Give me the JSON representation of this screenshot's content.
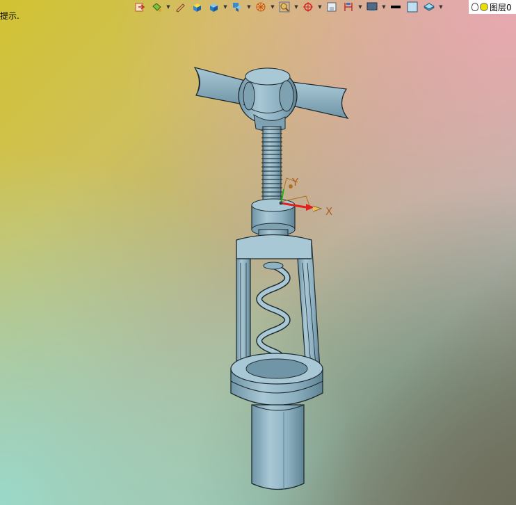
{
  "status": {
    "hint_text": "提示."
  },
  "toolbar": {
    "items": [
      {
        "name": "open-file-icon"
      },
      {
        "name": "paint-bucket-icon",
        "dropdown": true
      },
      {
        "name": "pen-icon"
      },
      {
        "name": "shaded-box-icon"
      },
      {
        "name": "view-cube-icon",
        "dropdown": true
      },
      {
        "name": "view-orientation-icon",
        "dropdown": true
      },
      {
        "name": "render-mode-icon",
        "dropdown": true
      },
      {
        "name": "zoom-frame-icon",
        "dropdown": true
      },
      {
        "name": "crosshair-icon",
        "dropdown": true
      },
      {
        "name": "section-view-icon"
      },
      {
        "name": "dimension-icon",
        "dropdown": true
      },
      {
        "name": "display-mode-icon",
        "dropdown": true
      },
      {
        "name": "line-color-icon"
      },
      {
        "name": "fill-color-icon"
      },
      {
        "name": "layers-icon",
        "dropdown": true
      }
    ]
  },
  "layer": {
    "label": "图层0"
  },
  "axes": {
    "x_label": "X",
    "y_label": "Y"
  },
  "colors": {
    "model_fill": "#8fb3c2",
    "model_edge": "#1f2a30",
    "axis_x": "#e02020",
    "axis_y": "#20b020",
    "triad": "#b07020"
  }
}
